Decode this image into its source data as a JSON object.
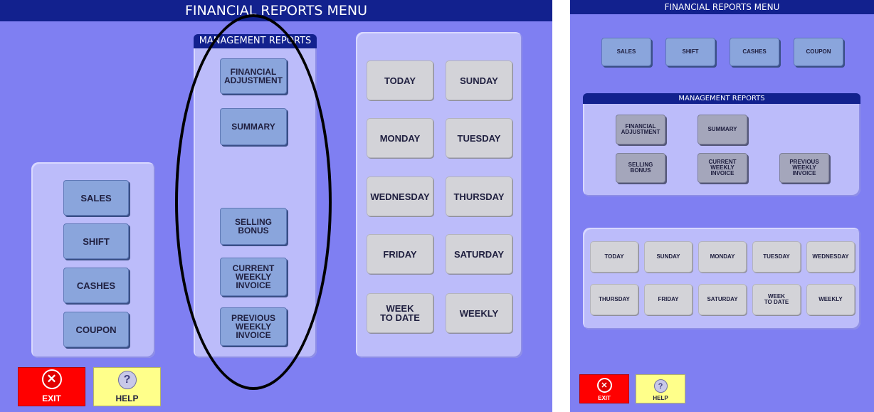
{
  "left_screen": {
    "title": "FINANCIAL REPORTS MENU",
    "report_type_buttons": [
      "SALES",
      "SHIFT",
      "CASHES",
      "COUPON"
    ],
    "management_reports": {
      "label": "MANAGEMENT REPORTS",
      "buttons": [
        "FINANCIAL\nADJUSTMENT",
        "SUMMARY",
        "SELLING\nBONUS",
        "CURRENT\nWEEKLY\nINVOICE",
        "PREVIOUS\nWEEKLY\nINVOICE"
      ]
    },
    "period_buttons": [
      "TODAY",
      "SUNDAY",
      "MONDAY",
      "TUESDAY",
      "WEDNESDAY",
      "THURSDAY",
      "FRIDAY",
      "SATURDAY",
      "WEEK\nTO DATE",
      "WEEKLY"
    ],
    "exit_label": "EXIT",
    "help_label": "HELP"
  },
  "right_screen": {
    "title": "FINANCIAL REPORTS MENU",
    "report_type_buttons": [
      "SALES",
      "SHIFT",
      "CASHES",
      "COUPON"
    ],
    "management_reports": {
      "label": "MANAGEMENT REPORTS",
      "buttons": [
        "FINANCIAL\nADJUSTMENT",
        "SUMMARY",
        "SELLING\nBONUS",
        "CURRENT\nWEEKLY\nINVOICE",
        "PREVIOUS\nWEEKLY\nINVOICE"
      ]
    },
    "period_buttons": [
      "TODAY",
      "SUNDAY",
      "MONDAY",
      "TUESDAY",
      "WEDNESDAY",
      "THURSDAY",
      "FRIDAY",
      "SATURDAY",
      "WEEK\nTO DATE",
      "WEEKLY"
    ],
    "exit_label": "EXIT",
    "help_label": "HELP"
  },
  "icons": {
    "exit": "close-circle-icon",
    "help": "question-circle-icon"
  },
  "colors": {
    "background": "#7f7ff2",
    "title_bar": "#12218e",
    "panel": "#bcbcfa",
    "report_button": "#8aa5dc",
    "period_button": "#d3d3d8",
    "management_button_right": "#a4a6bb",
    "exit": "#ff0000",
    "help": "#ffff8a",
    "annotation_oval": "#000000"
  }
}
